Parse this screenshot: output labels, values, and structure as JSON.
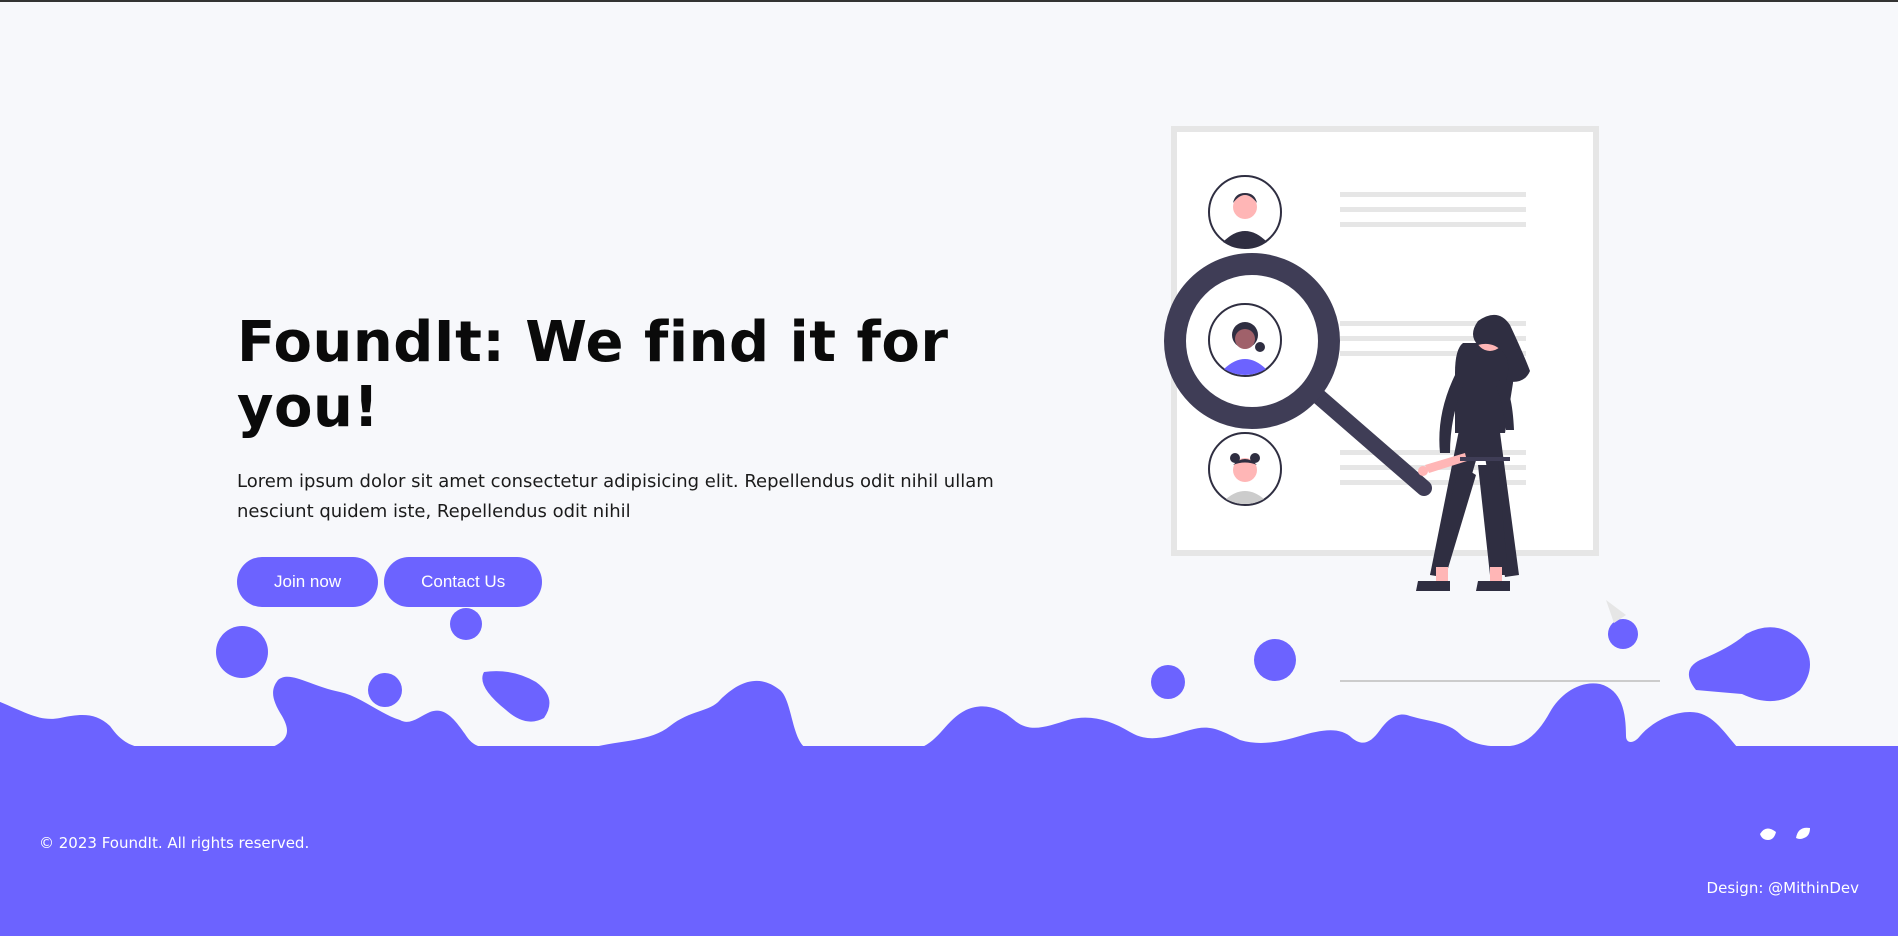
{
  "hero": {
    "title": "FoundIt: We find it for you!",
    "description": "Lorem ipsum dolor sit amet consectetur adipisicing elit. Repellendus odit nihil ullam nesciunt quidem iste, Repellendus odit nihil",
    "buttons": {
      "join_label": "Join now",
      "contact_label": "Contact Us"
    }
  },
  "footer": {
    "copyright": "© 2023 FoundIt. All rights reserved.",
    "credit": "Design: @MithinDev",
    "social_icons": [
      "social-icon-left",
      "social-icon-right"
    ]
  },
  "illustration": {
    "icon": "search-profiles-illustration"
  },
  "colors": {
    "accent": "#6c63ff",
    "background": "#f7f8fb",
    "dark": "#2f2e41",
    "skin": "#ffb6b6",
    "paper_border": "#e6e6e6"
  }
}
